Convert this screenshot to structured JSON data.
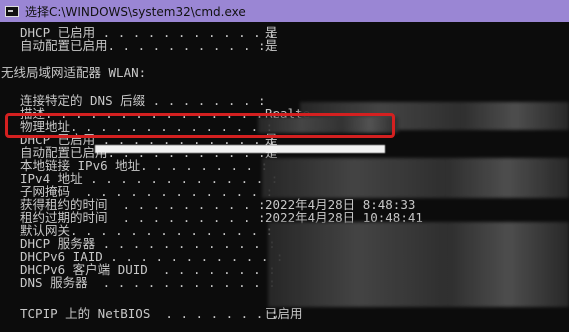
{
  "window": {
    "title": "选择C:\\WINDOWS\\system32\\cmd.exe"
  },
  "console": {
    "top_lines": [
      {
        "label": "DHCP 已启用 . . . . . . . . . . . :",
        "value": "是"
      },
      {
        "label": "自动配置已启用. . . . . . . . . . :",
        "value": "是"
      }
    ],
    "adapter_header": "无线局域网适配器 WLAN:",
    "rows": [
      {
        "label": "连接特定的 DNS 后缀 . . . . . . . :",
        "value": ""
      },
      {
        "label": "描述. . . . . . . . . . . . . . . :",
        "value": "Realte"
      },
      {
        "label": "物理地址. . . . . . . . . . . . . :",
        "value": ""
      },
      {
        "label": "DHCP 已启用 . . . . . . . . . . . :",
        "value": "是"
      },
      {
        "label": "自动配置已启用. . . . . . . . . . :",
        "value": "是"
      },
      {
        "label": "本地链接 IPv6 地址. . . . . . . . :",
        "value": ""
      },
      {
        "label": "IPv4 地址 . . . . . . . . . . . . :",
        "value": ""
      },
      {
        "label": "子网掩码  . . . . . . . . . . . . :",
        "value": ""
      },
      {
        "label": "获得租约的时间  . . . . . . . . . :",
        "value": "2022年4月28日 8:48:33"
      },
      {
        "label": "租约过期的时间  . . . . . . . . . :",
        "value": "2022年4月28日 10:48:41"
      },
      {
        "label": "默认网关. . . . . . . . . . . . . :",
        "value": ""
      },
      {
        "label": "DHCP 服务器 . . . . . . . . . . . :",
        "value": ""
      },
      {
        "label": "DHCPv6 IAID . . . . . . . . . . . :",
        "value": ""
      },
      {
        "label": "DHCPv6 客户端 DUID  . . . . . . . :",
        "value": ""
      },
      {
        "label": "DNS 服务器  . . . . . . . . . . . :",
        "value": ""
      },
      {
        "label": "",
        "value": ""
      },
      {
        "label": "TCPIP 上的 NetBIOS  . . . . . . . :",
        "value": "已启用"
      }
    ]
  },
  "colors": {
    "titlebar": "#9a86d4",
    "highlight": "#d42020",
    "text": "#c8c8c8",
    "background": "#0c0c0c"
  }
}
